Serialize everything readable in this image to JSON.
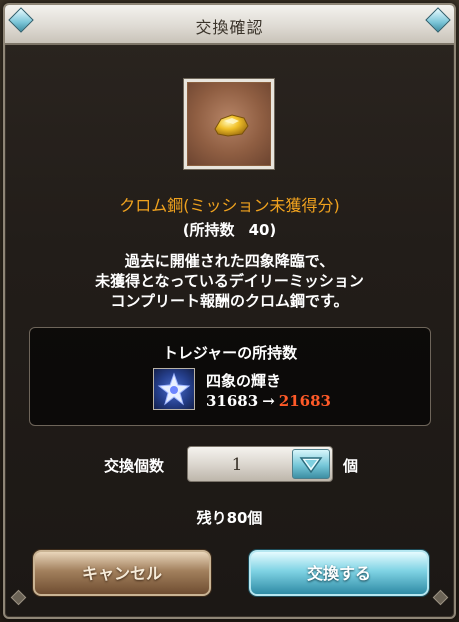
{
  "dialog": {
    "title": "交換確認"
  },
  "item": {
    "icon": "chrome-steel-nugget-icon",
    "name": "クロム鋼(ミッション未獲得分)",
    "owned_label": "(所持数",
    "owned_value": "40)",
    "description_lines": [
      "過去に開催された四象降臨で、",
      "未獲得となっているデイリーミッション",
      "コンプリート報酬のクロム鋼です。"
    ]
  },
  "treasure": {
    "heading": "トレジャーの所持数",
    "icon": "four-symbols-star-icon",
    "name": "四象の輝き",
    "current": "31683",
    "arrow": "→",
    "after": "21683"
  },
  "quantity": {
    "label": "交換個数",
    "value": "1",
    "unit": "個"
  },
  "remaining": "残り80個",
  "buttons": {
    "cancel": "キャンセル",
    "confirm": "交換する"
  },
  "colors": {
    "item_name": "#f0a21e",
    "after_count": "#ff5a28"
  }
}
